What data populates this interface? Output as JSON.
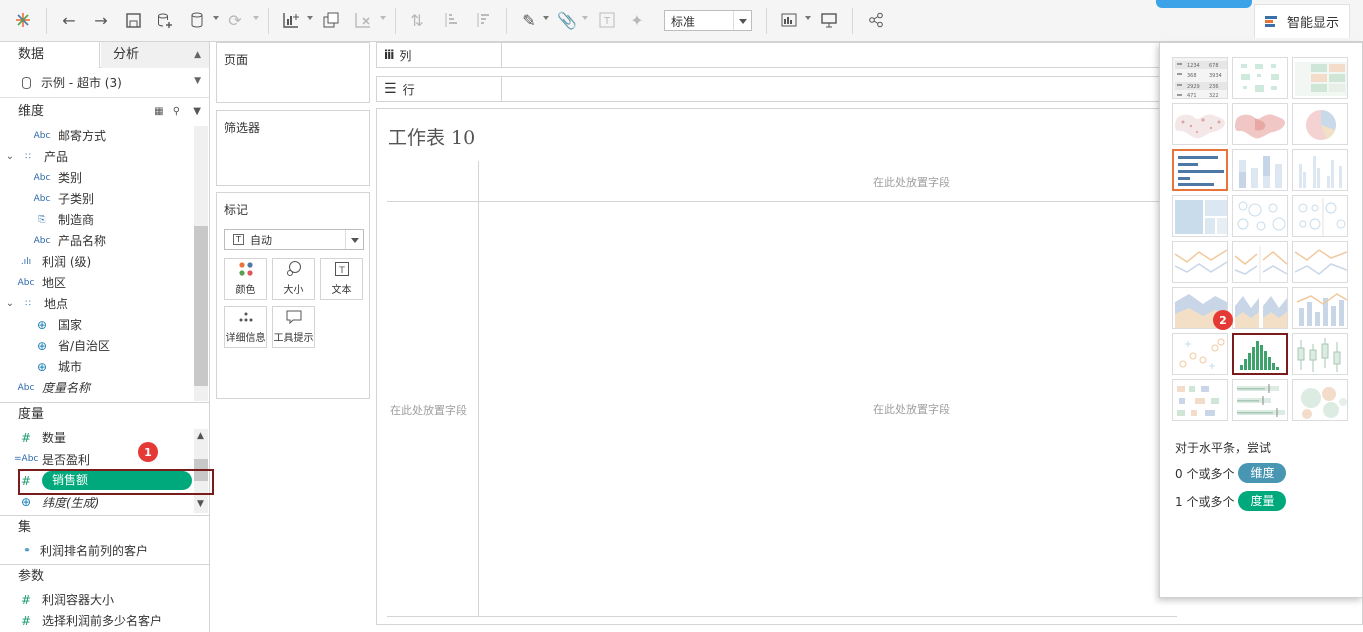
{
  "toolbar": {
    "fit_select": "标准",
    "showme_label": "智能显示"
  },
  "data_pane": {
    "tab_data": "数据",
    "tab_analysis": "分析",
    "datasource": "示例 - 超市 (3)",
    "dimensions_header": "维度",
    "dimensions": [
      {
        "type": "Abc",
        "label": "邮寄方式",
        "indent": 1
      },
      {
        "type": "hierarchy",
        "label": "产品",
        "indent": 0
      },
      {
        "type": "Abc",
        "label": "类别",
        "indent": 1
      },
      {
        "type": "Abc",
        "label": "子类别",
        "indent": 1
      },
      {
        "type": "clip",
        "label": "制造商",
        "indent": 1
      },
      {
        "type": "Abc",
        "label": "产品名称",
        "indent": 1
      },
      {
        "type": "bin",
        "label": "利润 (级)",
        "indent": 0
      },
      {
        "type": "Abc",
        "label": "地区",
        "indent": 0
      },
      {
        "type": "hierarchy",
        "label": "地点",
        "indent": 0
      },
      {
        "type": "globe",
        "label": "国家",
        "indent": 1
      },
      {
        "type": "globe",
        "label": "省/自治区",
        "indent": 1
      },
      {
        "type": "globe",
        "label": "城市",
        "indent": 1
      },
      {
        "type": "Abc",
        "label": "度量名称",
        "indent": 0,
        "italic": true
      }
    ],
    "measures_header": "度量",
    "measures": [
      {
        "type": "#",
        "label": "数量"
      },
      {
        "type": "=Abc",
        "label": "是否盈利"
      },
      {
        "type": "#",
        "label": "销售额",
        "selected": true
      },
      {
        "type": "globe",
        "label": "纬度(生成)",
        "italic": true
      }
    ],
    "sets_header": "集",
    "sets": [
      {
        "label": "利润排名前列的客户"
      }
    ],
    "params_header": "参数",
    "params": [
      {
        "type": "#",
        "label": "利润容器大小"
      },
      {
        "type": "#",
        "label": "选择利润前多少名客户"
      }
    ]
  },
  "cards": {
    "pages": "页面",
    "filters": "筛选器",
    "marks": "标记",
    "mark_type": "自动",
    "buttons": {
      "color": "颜色",
      "size": "大小",
      "text": "文本",
      "detail": "详细信息",
      "tooltip": "工具提示"
    }
  },
  "shelves": {
    "columns": "列",
    "rows": "行"
  },
  "view": {
    "title": "工作表 10",
    "drop_top": "在此处放置字段",
    "drop_left": "在此处放置字段",
    "drop_center": "在此处放置字段"
  },
  "showme": {
    "hint_line": "对于水平条，尝试",
    "dims_prefix": "0 个或多个",
    "dims_chip": "维度",
    "meas_prefix": "1 个或多个",
    "meas_chip": "度量",
    "text_table_numbers": [
      "1234",
      "678",
      "368",
      "3934",
      "2929",
      "236",
      "471",
      "322"
    ]
  },
  "annotations": {
    "badge1": "1",
    "badge2": "2"
  },
  "colors": {
    "pill_green": "#00a97b",
    "dims_chip": "#4996b2",
    "meas_chip": "#00a97b",
    "highlight": "#7a1c1c",
    "badge": "#e53935",
    "selected_orange": "#e8743b"
  }
}
